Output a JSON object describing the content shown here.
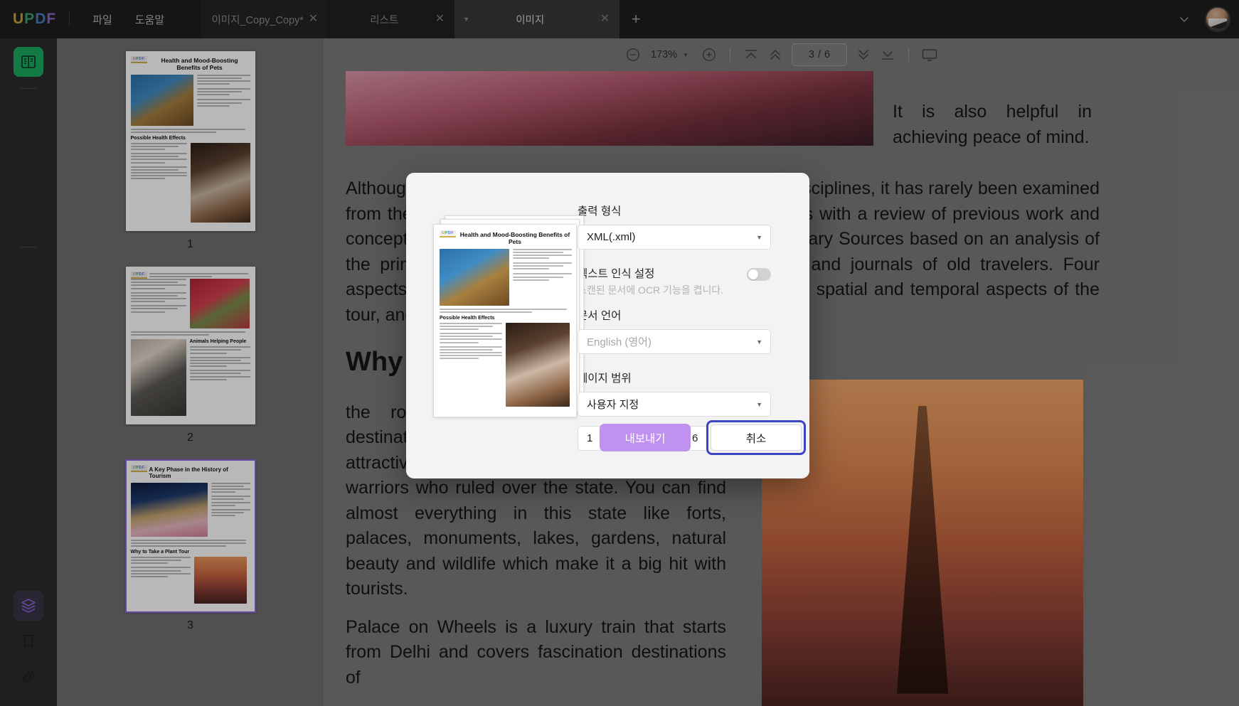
{
  "app": {
    "name": "UPDF",
    "logo_letters": [
      "U",
      "P",
      "D",
      "F"
    ],
    "logo_colors": [
      "#c8a23c",
      "#3ea06a",
      "#4a7fc4",
      "#8b63c8"
    ]
  },
  "menu": [
    {
      "label": "파일",
      "name": "menu-file"
    },
    {
      "label": "도움말",
      "name": "menu-help"
    }
  ],
  "tabs": [
    {
      "label": "이미지_Copy_Copy*",
      "active": false,
      "close": "✕"
    },
    {
      "label": "리스트",
      "active": false,
      "close": "✕"
    },
    {
      "label": "이미지",
      "active": true,
      "close": "✕",
      "caret": "▼"
    }
  ],
  "tab_add_label": "+",
  "toolbar": {
    "zoom_out": "−",
    "zoom_value": "173%",
    "zoom_caret": "▼",
    "zoom_in": "+",
    "page_current": "3",
    "page_separator": "/",
    "page_total": "6"
  },
  "sidebar": {
    "items": [
      {
        "name": "sidebar-item-reader",
        "label": "Reader",
        "active": true
      },
      {
        "name": "sidebar-item-highlight",
        "label": "Annotate",
        "active": false
      },
      {
        "name": "sidebar-item-edit",
        "label": "Edit PDF",
        "active": false
      },
      {
        "name": "sidebar-item-organize",
        "label": "Organize Pages",
        "active": false
      },
      {
        "name": "sidebar-item-form",
        "label": "Form",
        "active": false
      },
      {
        "name": "sidebar-item-convert",
        "label": "Convert",
        "active": false
      },
      {
        "name": "sidebar-item-crop",
        "label": "Crop",
        "active": false
      },
      {
        "name": "sidebar-item-batch",
        "label": "Batch",
        "active": false
      }
    ],
    "bottom_items": [
      {
        "name": "sidebar-item-layers",
        "label": "Layers",
        "active": true
      },
      {
        "name": "sidebar-item-bookmark",
        "label": "Bookmark",
        "active": false
      },
      {
        "name": "sidebar-item-attachment",
        "label": "Attachment",
        "active": false
      }
    ]
  },
  "thumbnails": [
    {
      "number": "1",
      "title": "Health and Mood-Boosting Benefits of Pets",
      "section": "Possible Health Effects",
      "selected": false
    },
    {
      "number": "2",
      "title": "",
      "section": "Animals Helping People",
      "selected": false
    },
    {
      "number": "3",
      "title": "A Key Phase in the History of Tourism",
      "section": "Why to Take a Plant Tour",
      "selected": true
    }
  ],
  "document": {
    "paragraph_top_right": "It is also helpful in achieving peace of mind.",
    "paragraph_1": "Although this travel Tour has been examined by various disciplines, it has rarely been examined from the perspective of tourism studies. This paper begins with a review of previous work and concepts about the tour and from various areas of its primary Sources based on an analysis of the primary sources of information can stories, letters, and journals of old travelers. Four aspects of the Grand Tour are then examined: the routes, spatial and temporal aspects of the tour, and the gradual development of a tourist industry.",
    "heading": "Why to Take a Plant Tour",
    "paragraph_2": "the royal palaces and monuments, this destination is a delight for travelers and their attractive architecture tells the story of great warriors who ruled over the state. You can find almost everything in this state like forts, palaces, monuments, lakes, gardens, natural beauty and wildlife which make it a big hit with tourists.",
    "paragraph_3": "Palace on Wheels is a luxury train that starts from Delhi and covers fascination destinations of"
  },
  "dialog": {
    "output_format": {
      "label": "출력 형식",
      "value": "XML(.xml)",
      "caret": "▼"
    },
    "ocr": {
      "label": "텍스트 인식 설정",
      "description": "스캔된 문서에 OCR 기능을 켭니다.",
      "enabled": false
    },
    "language": {
      "label": "문서 언어",
      "value": "English (영어)",
      "is_placeholder": true,
      "caret": "▼"
    },
    "page_range": {
      "label": "페이지 범위",
      "value": "사용자 지정",
      "caret": "▼",
      "from": "1",
      "to": "6",
      "dash": "—",
      "spin_up": "▲",
      "spin_down": "▼"
    },
    "buttons": {
      "export": "내보내기",
      "cancel": "취소",
      "export_color": "#c092f0",
      "cancel_focus_color": "#3b46c4"
    }
  }
}
